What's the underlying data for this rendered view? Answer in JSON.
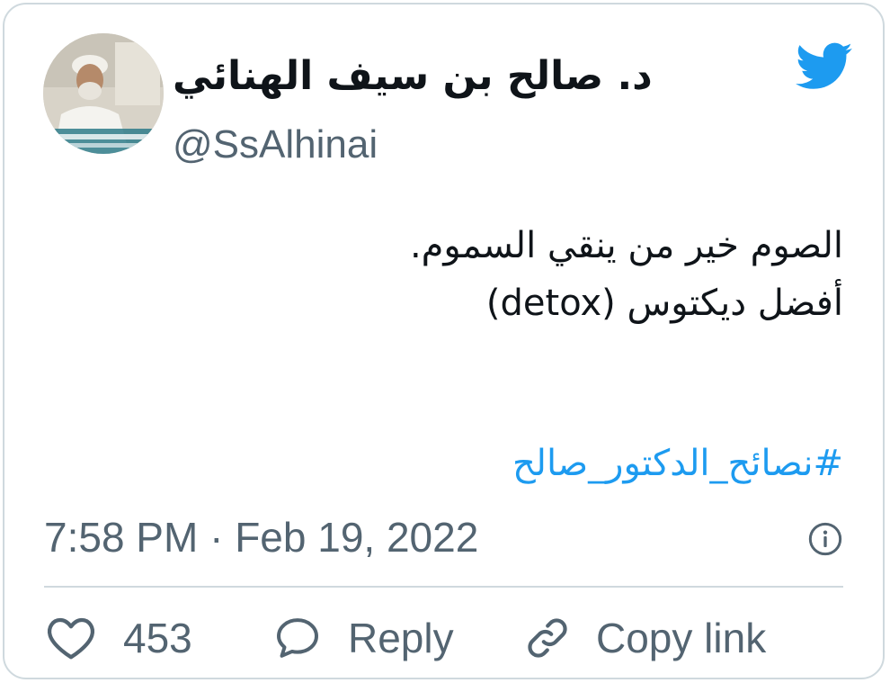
{
  "user": {
    "display_name": "د. صالح بن سيف الهنائي",
    "handle": "@SsAlhinai",
    "avatar_icon": "profile-photo"
  },
  "tweet": {
    "lines": [
      "الصوم خير من ينقي السموم.",
      "أفضل ديكتوس (detox)"
    ],
    "hashtag": "#نصائح_الدكتور_صالح",
    "timestamp": "7:58 PM · Feb 19, 2022"
  },
  "actions": {
    "like_count": "453",
    "reply_label": "Reply",
    "copy_link_label": "Copy link"
  },
  "icons": {
    "brand": "twitter-bird-icon",
    "info": "info-icon",
    "like": "heart-icon",
    "reply": "speech-bubble-icon",
    "copy": "link-icon"
  },
  "colors": {
    "brand_blue": "#1d9bf0",
    "secondary_text": "#536471",
    "border": "#cfd9de"
  }
}
